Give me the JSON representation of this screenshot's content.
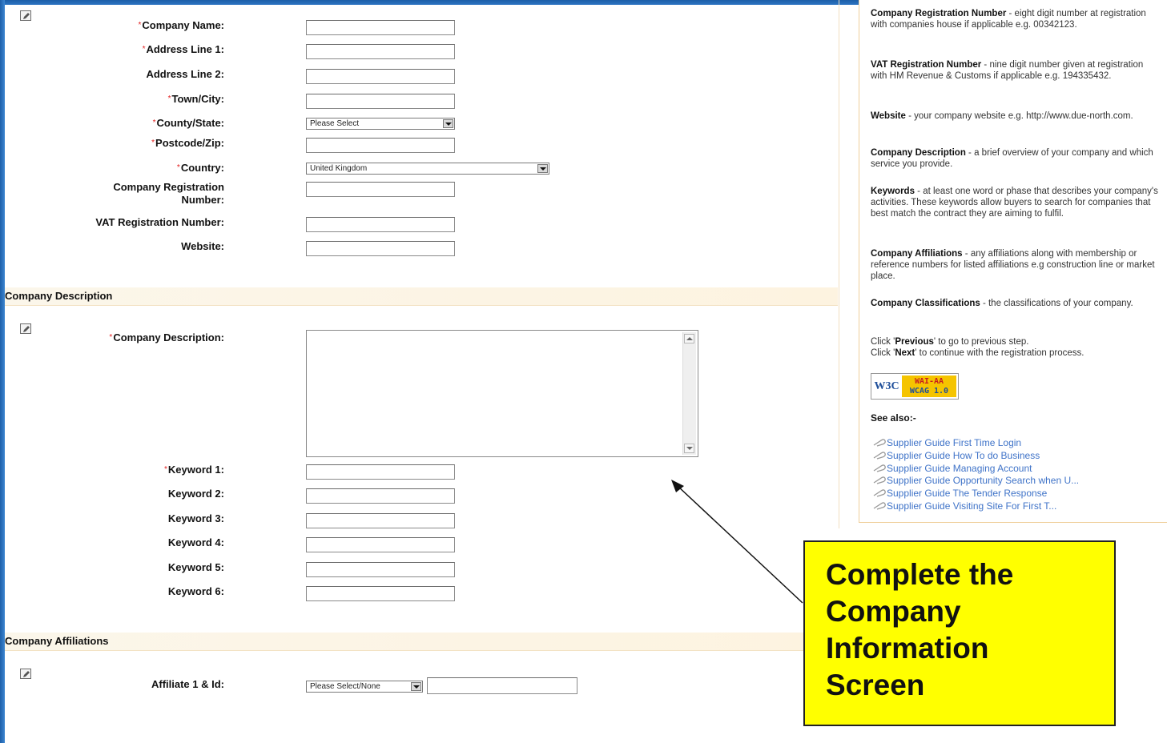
{
  "form": {
    "company_name_label": "Company Name:",
    "address1_label": "Address Line 1:",
    "address2_label": "Address Line 2:",
    "town_label": "Town/City:",
    "county_label": "County/State:",
    "county_value": "Please Select",
    "postcode_label": "Postcode/Zip:",
    "country_label": "Country:",
    "country_value": "United Kingdom",
    "reg_label_1": "Company Registration",
    "reg_label_2": "Number:",
    "vat_label": "VAT Registration Number:",
    "website_label": "Website:",
    "required_marker": "*"
  },
  "description_section": {
    "title": "Company Description",
    "description_label": "Company Description:",
    "keywords": [
      "Keyword 1:",
      "Keyword 2:",
      "Keyword 3:",
      "Keyword 4:",
      "Keyword 5:",
      "Keyword 6:"
    ]
  },
  "affiliations_section": {
    "title": "Company Affiliations",
    "affiliate_label": "Affiliate 1 & Id:",
    "affiliate_select_value": "Please Select/None"
  },
  "help": {
    "reg_term": "Company Registration Number",
    "reg_text": " - eight digit number at registration with companies house if applicable e.g. 00342123.",
    "vat_term": "VAT Registration Number",
    "vat_text": " - nine digit number given at registration with HM Revenue & Customs if applicable e.g. 194335432.",
    "web_term": "Website",
    "web_text": " - your company website e.g. http://www.due-north.com.",
    "desc_term": "Company Description",
    "desc_text": " - a brief overview of your company and which service you provide.",
    "kw_term": "Keywords",
    "kw_text": " - at least one word or phase that describes your company's activities. These keywords allow buyers to search for companies that best match the contract they are aiming to fulfil.",
    "aff_term": "Company Affiliations",
    "aff_text": " - any affiliations along with membership or reference numbers for listed affiliations e.g construction line or market place.",
    "class_term": "Company Classifications",
    "class_text": " - the classifications of your company.",
    "click1_a": "Click '",
    "click1_b": "Previous",
    "click1_c": "' to go to previous step.",
    "click2_a": "Click '",
    "click2_b": "Next",
    "click2_c": "' to continue with the registration process.",
    "badge_left": "W3C",
    "badge_top": "WAI-AA",
    "badge_bottom": "WCAG 1.0",
    "see_also": "See also:-",
    "links": [
      "Supplier Guide First Time Login",
      "Supplier Guide How To do Business",
      "Supplier Guide Managing Account",
      "Supplier Guide Opportunity Search when U...",
      "Supplier Guide The Tender Response",
      "Supplier Guide Visiting Site For First T..."
    ]
  },
  "callout": {
    "line1": "Complete the",
    "line2": "Company",
    "line3": "Information",
    "line4": "Screen"
  },
  "colors": {
    "frame_blue": "#1d5fa8",
    "required_red": "#e32020",
    "link_blue": "#3f73c8",
    "callout_yellow": "#ffff00"
  }
}
